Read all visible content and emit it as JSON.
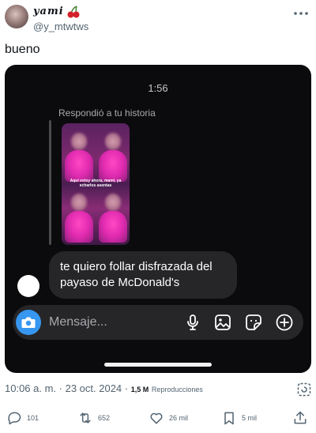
{
  "author": {
    "display_name": "yami",
    "handle": "@y_mtwtws",
    "emoji": "cherry-icon"
  },
  "tweet": {
    "text": "bueno"
  },
  "screenshot": {
    "time": "1:56",
    "replied_label": "Respondió a tu historia",
    "story_caption": "Aquí estoy ahora, mami, ya echarlos asentas",
    "message": "te quiero follar disfrazada del payaso de McDonald's",
    "composer_placeholder": "Mensaje...",
    "icons": [
      "camera-icon",
      "microphone-icon",
      "gallery-icon",
      "sticker-icon",
      "add-icon"
    ],
    "colors": {
      "background": "#0b0b0d",
      "bubble": "#262628",
      "camera": "#3797f0"
    }
  },
  "meta": {
    "timestamp": "10:06 a. m. · 23 oct. 2024 ·",
    "views_count": "1,5 M",
    "views_label": "Reproducciones"
  },
  "actions": {
    "replies": "101",
    "reposts": "652",
    "likes": "26 mil",
    "bookmarks": "5 mil"
  }
}
